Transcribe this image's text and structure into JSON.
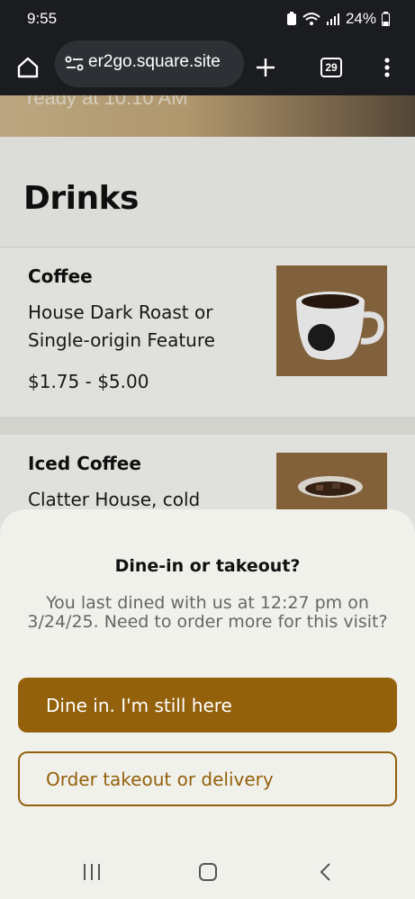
{
  "status": {
    "time": "9:55",
    "battery": "24%"
  },
  "browser": {
    "url": "er2go.square.site",
    "tab_count": "29"
  },
  "hero": {
    "text": "ready at 10:10 AM"
  },
  "menu": {
    "section_title": "Drinks",
    "items": [
      {
        "name": "Coffee",
        "description": "House Dark Roast or Single-origin Feature",
        "price": "$1.75 - $5.00",
        "image": "coffee-mug-image"
      },
      {
        "name": "Iced Coffee",
        "description": "Clatter House, cold",
        "price": "",
        "image": "iced-coffee-image"
      }
    ]
  },
  "dialog": {
    "title": "Dine-in or takeout?",
    "message": "You last dined with us at 12:27 pm on 3/24/25. Need to order more for this visit?",
    "primary_label": "Dine in. I'm still here",
    "secondary_label": "Order takeout or delivery"
  },
  "colors": {
    "accent": "#93600b",
    "sheet_bg": "#f1f1ec",
    "toolbar_bg": "#1b1c1f"
  },
  "icons": [
    "home-icon",
    "site-settings-icon",
    "new-tab-icon",
    "tab-switcher-icon",
    "more-menu-icon",
    "recent-apps-icon",
    "home-nav-icon",
    "back-nav-icon"
  ]
}
